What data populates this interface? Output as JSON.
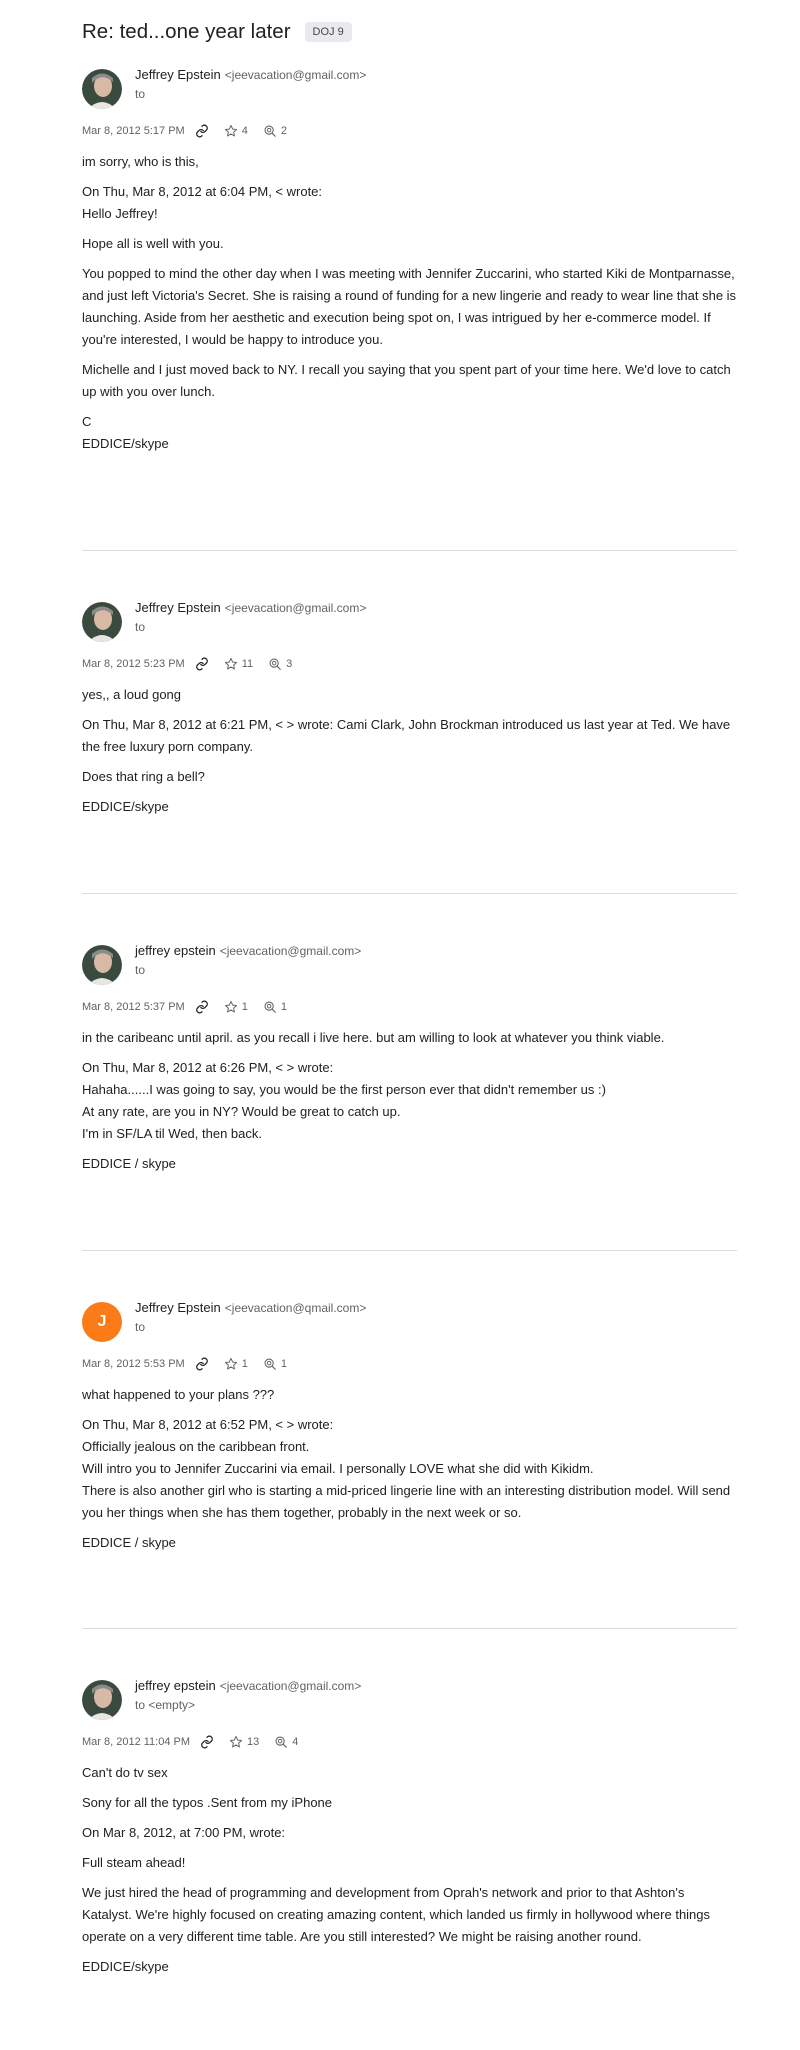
{
  "thread": {
    "subject": "Re: ted...one year later",
    "tag": "DOJ 9"
  },
  "messages": [
    {
      "avatar_letter": "",
      "sender_name": "Jeffrey Epstein",
      "sender_email": "<jeevacation@gmail.com>",
      "to_line": "to",
      "date": "Mar 8, 2012 5:17 PM",
      "stars": "4",
      "zoom": "2",
      "reply": "im sorry, who is this,",
      "quote_header": "On Thu, Mar 8, 2012 at 6:04 PM, < wrote:",
      "greeting": "Hello Jeffrey!",
      "para1": "Hope all is well with you.",
      "para2": "You popped to mind the other day when I was meeting with Jennifer Zuccarini, who started Kiki de Montparnasse, and just left Victoria's Secret. She is raising a round of funding for a new lingerie and ready to wear line that she is launching. Aside from her aesthetic and execution being spot on, I was intrigued by her e-commerce model. If you're interested, I would be happy to introduce you.",
      "para3": "Michelle and I just moved back to NY. I recall you saying that you spent part of your time here. We'd love to catch up with you over lunch.",
      "sig1": "C",
      "sig2": "EDDICE/skype"
    },
    {
      "avatar_letter": "",
      "sender_name": "Jeffrey Epstein",
      "sender_email": "<jeevacation@gmail.com>",
      "to_line": "to",
      "date": "Mar 8, 2012 5:23 PM",
      "stars": "11",
      "zoom": "3",
      "reply": "yes,, a loud gong",
      "para1": "On Thu, Mar 8, 2012 at 6:21 PM, < > wrote: Cami Clark, John Brockman introduced us last year at Ted. We have the free luxury porn company.",
      "para2": "Does that ring a bell?",
      "sig": "EDDICE/skype"
    },
    {
      "avatar_letter": "",
      "sender_name": "jeffrey epstein",
      "sender_email": "<jeevacation@gmail.com>",
      "to_line": "to",
      "date": "Mar 8, 2012 5:37 PM",
      "stars": "1",
      "zoom": "1",
      "reply": "in the caribeanc until april. as you recall i live here. but am willing to look at whatever you think viable.",
      "quote_header": "On Thu, Mar 8, 2012 at 6:26 PM, < > wrote:",
      "line1": "Hahaha......I was going to say, you would be the first person ever that didn't remember us :)",
      "line2": "At any rate, are you in NY? Would be great to catch up.",
      "line3": "I'm in SF/LA til Wed, then back.",
      "sig": "EDDICE / skype"
    },
    {
      "avatar_letter": "J",
      "sender_name": "Jeffrey Epstein",
      "sender_email": "<jeevacation@qmail.com>",
      "to_line": "to",
      "date": "Mar 8, 2012 5:53 PM",
      "stars": "1",
      "zoom": "1",
      "reply": "what happened to your plans ???",
      "quote_header": "On Thu, Mar 8, 2012 at 6:52 PM, < > wrote:",
      "line1": "Officially jealous on the caribbean front.",
      "line2": "Will intro you to Jennifer Zuccarini via email. I personally LOVE what she did with Kikidm.",
      "line3": "There is also another girl who is starting a mid-priced lingerie line with an interesting distribution model. Will send you her things when she has them together, probably in the next week or so.",
      "sig": "EDDICE / skype"
    },
    {
      "avatar_letter": "",
      "sender_name": "jeffrey epstein",
      "sender_email": "<jeevacation@gmail.com>",
      "to_line": "to <empty>",
      "date": "Mar 8, 2012 11:04 PM",
      "stars": "13",
      "zoom": "4",
      "reply": "Can't do tv sex",
      "sent_from": "Sony for all the typos .Sent from my iPhone",
      "quote_header": "On Mar 8, 2012, at 7:00 PM, wrote:",
      "para1": "Full steam ahead!",
      "para2": "We just hired the head of programming and development from Oprah's network and prior to that Ashton's Katalyst. We're highly focused on creating amazing content, which landed us firmly in hollywood where things operate on a very different time table. Are you still interested? We might be raising another round.",
      "sig": "EDDICE/skype"
    }
  ],
  "icons": {
    "link": "link-icon",
    "star": "star-icon",
    "zoom": "zoom-search-icon",
    "avatar": "profile-photo"
  }
}
